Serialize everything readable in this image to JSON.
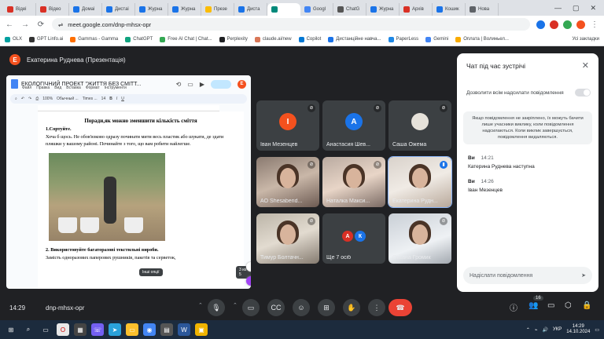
{
  "browser": {
    "tabs": [
      {
        "label": "Відеі",
        "color": "#d93025"
      },
      {
        "label": "Відео",
        "color": "#d93025"
      },
      {
        "label": "Домаі",
        "color": "#1a73e8"
      },
      {
        "label": "Дистаі",
        "color": "#1a73e8"
      },
      {
        "label": "Журна",
        "color": "#1a73e8"
      },
      {
        "label": "Журна",
        "color": "#1a73e8"
      },
      {
        "label": "Презе",
        "color": "#fbbc04"
      },
      {
        "label": "Диста",
        "color": "#1a73e8"
      },
      {
        "label": "",
        "color": "#00897b",
        "active": true
      },
      {
        "label": "Googl",
        "color": "#4285f4"
      },
      {
        "label": "ChatG",
        "color": "#555555"
      },
      {
        "label": "Журна",
        "color": "#1a73e8"
      },
      {
        "label": "Архів",
        "color": "#d93025"
      },
      {
        "label": "Кошик",
        "color": "#1a73e8"
      },
      {
        "label": "Нова",
        "color": "#5f6368"
      }
    ],
    "url": "meet.google.com/dnp-mhsx-opr",
    "bookmarks": [
      "OLX",
      "GPT Linfo.ai",
      "Gammas - Gamma",
      "ChatGPT",
      "Free AI Chat | Chat...",
      "Perplexity",
      "claude.ai/new",
      "Copilot",
      "Дистанційне навча...",
      "PaperLess",
      "Gemini",
      "Оплата | Волиньел..."
    ],
    "all_bookmarks": "Усі закладки"
  },
  "meet": {
    "presenter_initial": "E",
    "presenter_label": "Екатерина Руднева (Презентація)",
    "meeting_time": "14:29",
    "meeting_code": "dnp-mhsx-opr",
    "participants_count": "16"
  },
  "doc": {
    "title": "ЕКОЛОГІЧНИЙ ПРОЕКТ \"ЖИТТЯ БЕЗ СМІТТ...",
    "menus": [
      "Файл",
      "Правка",
      "Вид",
      "Вставка",
      "Формат",
      "Інструменти"
    ],
    "style": "Обычный ...",
    "font": "Times ...",
    "size": "14",
    "heading": "Поради,як можно зменшити кількість сміття",
    "item1": "1.Сортуйте.",
    "para1": "Хоча б щось. Не обов'язково одразу починати мити весь пластик або шукати, де здати пляшки у вашому районі. Починайте з того, що вам робити найлегше.",
    "item2": "2. Використовуйте багаторазові текстильні вироби.",
    "para2": "Замість одноразових паперових рушників, пакетів та серветок,",
    "photo_tip": "Інші опції",
    "page_indicator": "3 из 5"
  },
  "tiles": [
    {
      "name": "Іван Мезенцев",
      "initial": "І",
      "color": "#f4511e",
      "type": "avatar"
    },
    {
      "name": "Анастасия Шев...",
      "initial": "А",
      "color": "#1a73e8",
      "type": "avatar"
    },
    {
      "name": "Саша Ожема",
      "initial": "",
      "color": "#e6e2da",
      "type": "photo"
    },
    {
      "name": "AO Shesaberid...",
      "type": "cam"
    },
    {
      "name": "Наталка Макси...",
      "type": "cam"
    },
    {
      "name": "Екатерина Рудн...",
      "type": "cam",
      "speaking": true
    },
    {
      "name": "Тимур Болтачн...",
      "type": "cam"
    },
    {
      "name": "Ще 7 осіб",
      "type": "more",
      "initials": [
        "А",
        "К"
      ]
    },
    {
      "name": "Оксана Громик",
      "type": "cam"
    }
  ],
  "chat": {
    "title": "Чат під час зустрічі",
    "allow_label": "Дозволити всім надсилати повідомлення",
    "notice": "Якщо повідомлення не закріплено, їх можуть бачити лише учасники виклику, коли повідомлення надсилаються. Коли виклик завершується, повідомлення видаляються.",
    "messages": [
      {
        "who": "Ви",
        "time": "14:21",
        "text": "Катерина Руднева наступна"
      },
      {
        "who": "Ви",
        "time": "14:26",
        "text": "Іван Мезенцев"
      }
    ],
    "input_placeholder": "Надіслати повідомлення"
  },
  "taskbar": {
    "lang": "УКР",
    "time": "14:29",
    "date": "14.10.2024"
  }
}
